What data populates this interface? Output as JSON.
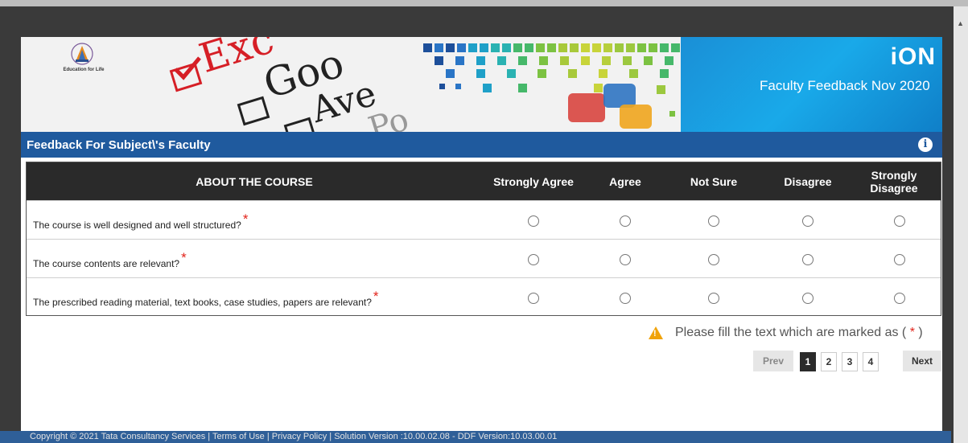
{
  "banner": {
    "logo_text": "Education for Life",
    "words": [
      "Exc",
      "Goo",
      "Ave",
      "Po"
    ],
    "ion_logo": "iON",
    "title": "Faculty Feedback Nov 2020"
  },
  "section": {
    "title": "Feedback For Subject\\'s Faculty"
  },
  "table": {
    "header": "ABOUT THE COURSE",
    "options": [
      "Strongly Agree",
      "Agree",
      "Not Sure",
      "Disagree",
      "Strongly Disagree"
    ],
    "questions": [
      "The course is well designed and well structured?",
      "The course contents are relevant?",
      "The prescribed reading material, text books, case studies, papers are relevant?"
    ],
    "required_mark": "*"
  },
  "warning": {
    "text": "Please fill the text which are marked as (",
    "mark": "*",
    "close": ")"
  },
  "pagination": {
    "prev": "Prev",
    "pages": [
      "1",
      "2",
      "3",
      "4"
    ],
    "active": "1",
    "next": "Next"
  },
  "footer": {
    "text": "Copyright © 2021 Tata Consultancy Services | Terms of Use | Privacy Policy | Solution Version :10.00.02.08 - DDF Version:10.03.00.01"
  },
  "colors": {
    "section_bar": "#1f5a9e",
    "header_dark": "#2a2a2a",
    "required": "#e2231a",
    "warning": "#f0a30a"
  }
}
